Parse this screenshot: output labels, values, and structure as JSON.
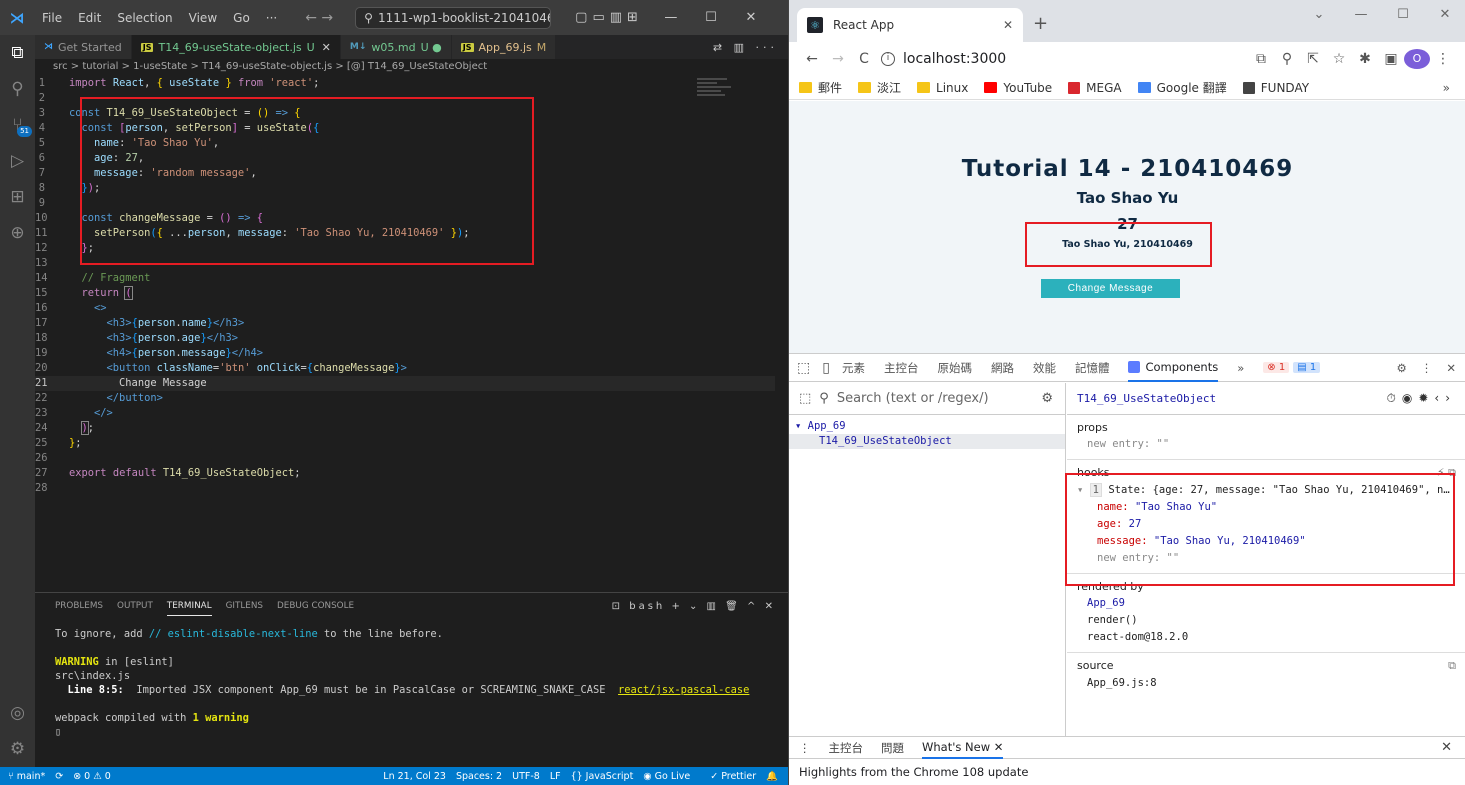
{
  "vscode": {
    "menu": [
      "File",
      "Edit",
      "Selection",
      "View",
      "Go",
      "···"
    ],
    "search": "1111-wp1-booklist-210410469",
    "tabs": [
      {
        "label": "Get Started",
        "badge": ""
      },
      {
        "label": "T14_69-useState-object.js",
        "badge": "U"
      },
      {
        "label": "w05.md",
        "badge": "U ●"
      },
      {
        "label": "App_69.js",
        "badge": "M"
      }
    ],
    "breadcrumb": "src > tutorial > 1-useState > T14_69-useState-object.js > [@] T14_69_UseStateObject",
    "activity_badge": "51",
    "panel_tabs": [
      "PROBLEMS",
      "OUTPUT",
      "TERMINAL",
      "GITLENS",
      "DEBUG CONSOLE"
    ],
    "panel_shell": "bash",
    "terminal": {
      "line1_pre": "To ignore, add ",
      "line1_cmt": "// eslint-disable-next-line",
      "line1_post": " to the line before.",
      "warn_word": "WARNING",
      "warn_rest": " in [eslint]",
      "file": "src\\index.js",
      "detail_loc": "  Line 8:5:",
      "detail_msg": "  Imported JSX component App_69 must be in PascalCase or SCREAMING_SNAKE_CASE  ",
      "detail_rule": "react/jsx-pascal-case",
      "compiled_pre": "webpack compiled with ",
      "compiled_bold": "1 warning"
    },
    "status": {
      "branch": "main*",
      "problems": "⊗ 0 ⚠ 0",
      "position": "Ln 21, Col 23",
      "spaces": "Spaces: 2",
      "encoding": "UTF-8",
      "eol": "LF",
      "lang": "{} JavaScript",
      "golive": "Go Live",
      "prettier": "✓ Prettier"
    }
  },
  "code_numbers": [
    "1",
    "2",
    "3",
    "4",
    "5",
    "6",
    "7",
    "8",
    "9",
    "10",
    "11",
    "12",
    "13",
    "14",
    "15",
    "16",
    "17",
    "18",
    "19",
    "20",
    "21",
    "22",
    "23",
    "24",
    "25",
    "26",
    "27",
    "28"
  ],
  "chrome": {
    "tab_title": "React App",
    "url": "localhost:3000",
    "bookmarks": [
      {
        "label": "郵件",
        "kind": "folder"
      },
      {
        "label": "淡江",
        "kind": "folder"
      },
      {
        "label": "Linux",
        "kind": "folder"
      },
      {
        "label": "YouTube",
        "kind": "yt"
      },
      {
        "label": "MEGA",
        "kind": "mega"
      },
      {
        "label": "Google 翻譯",
        "kind": "gt"
      },
      {
        "label": "FUNDAY",
        "kind": "globe"
      }
    ],
    "avatar": "O",
    "page": {
      "title": "Tutorial 14 - 210410469",
      "name": "Tao Shao Yu",
      "age": "27",
      "message": "Tao Shao Yu, 210410469",
      "button": "Change Message"
    },
    "devtools": {
      "tabs": [
        "元素",
        "主控台",
        "原始碼",
        "網路",
        "效能",
        "記憶體"
      ],
      "active_tab": "Components",
      "errors": "1",
      "messages": "1",
      "search_placeholder": "Search (text or /regex/)",
      "tree_root": "▾ App_69",
      "tree_child": "T14_69_UseStateObject",
      "selected": "T14_69_UseStateObject",
      "props_label": "props",
      "props_entry": "new entry: \"\"",
      "hooks_label": "hooks",
      "hook_line": "State: {age: 27, message: \"Tao Shao Yu, 210410469\", n…",
      "hook_index": "1",
      "hook_name_key": "name:",
      "hook_name_val": "\"Tao Shao Yu\"",
      "hook_age_key": "age:",
      "hook_age_val": "27",
      "hook_msg_key": "message:",
      "hook_msg_val": "\"Tao Shao Yu, 210410469\"",
      "hook_new": "new entry: \"\"",
      "rendered_label": "rendered by",
      "rendered": [
        "App_69",
        "render()",
        "react-dom@18.2.0"
      ],
      "source_label": "source",
      "source_val": "App_69.js:8",
      "drawer_tabs": [
        "主控台",
        "問題",
        "What's New"
      ],
      "drawer_msg": "Highlights from the Chrome 108 update"
    }
  }
}
